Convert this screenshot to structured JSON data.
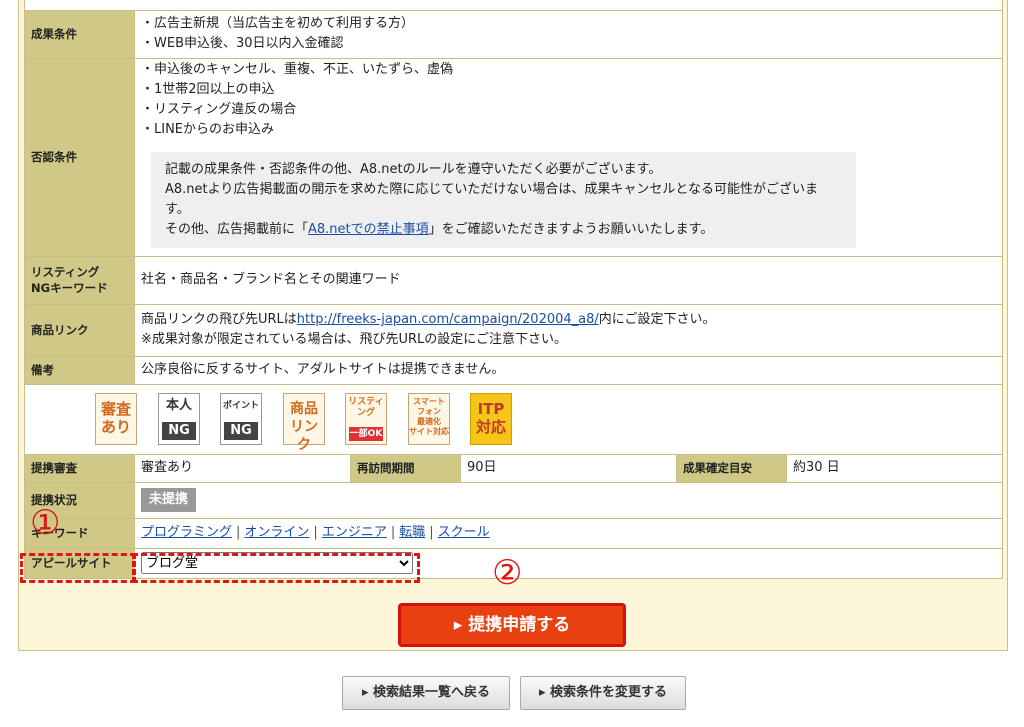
{
  "rows": {
    "success": {
      "label": "成果条件",
      "lines": [
        "・広告主新規（当広告主を初めて利用する方）",
        "・WEB申込後、30日以内入金確認"
      ]
    },
    "reject": {
      "label": "否認条件",
      "lines": [
        "・申込後のキャンセル、重複、不正、いたずら、虚偽",
        "・1世帯2回以上の申込",
        "・リスティング違反の場合",
        "・LINEからのお申込み"
      ],
      "note_line1": "記載の成果条件・否認条件の他、A8.netのルールを遵守いただく必要がございます。",
      "note_line2": "A8.netより広告掲載面の開示を求めた際に応じていただけない場合は、成果キャンセルとなる可能性がございます。",
      "note_line3_pre": "その他、広告掲載前に「",
      "note_link": "A8.netでの禁止事項",
      "note_line3_post": "」をご確認いただきますようお願いいたします。"
    },
    "listing": {
      "label_line1": "リスティング",
      "label_line2": "NGキーワード",
      "value": "社名・商品名・ブランド名とその関連ワード"
    },
    "product_link": {
      "label": "商品リンク",
      "pre": "商品リンクの飛び先URLは",
      "url": "http://freeks-japan.com/campaign/202004_a8/",
      "post": "内にご設定下さい。",
      "note": "※成果対象が限定されている場合は、飛び先URLの設定にご注意下さい。"
    },
    "remarks": {
      "label": "備考",
      "value": "公序良俗に反するサイト、アダルトサイトは提携できません。"
    },
    "review": {
      "label": "提携審査",
      "value": "審査あり",
      "revisit_label": "再訪問期間",
      "revisit_value": "90日",
      "confirm_label": "成果確定目安",
      "confirm_value": "約30 日"
    },
    "status": {
      "label": "提携状況",
      "value": "未提携"
    },
    "keywords": {
      "label": "キーワード",
      "items": [
        "プログラミング",
        "オンライン",
        "エンジニア",
        "転職",
        "スクール"
      ],
      "separator": "|"
    },
    "appeal": {
      "label": "アピールサイト",
      "selected": "ブログ堂"
    }
  },
  "badges": {
    "review": [
      "審査",
      "あり"
    ],
    "identity": {
      "top": "本人",
      "bottom": "NG"
    },
    "points": {
      "top": "ポイント",
      "bottom": "NG"
    },
    "product_link": [
      "商品",
      "リンク"
    ],
    "listing": {
      "top": "リスティ ング",
      "bottom": "一部OK"
    },
    "smartphone": [
      "スマート",
      "フォン",
      "最適化",
      "サイト対応"
    ],
    "itp": [
      "ITP",
      "対応"
    ]
  },
  "annotations": {
    "num1": "①",
    "num2": "②"
  },
  "buttons": {
    "submit": "▸ 提携申請する",
    "back": "▸ 検索結果一覧へ戻る",
    "change": "▸ 検索条件を変更する"
  },
  "colors": {
    "label_bg": "#cfc887",
    "panel_bg": "#fdf6d9",
    "submit_bg": "#e84010",
    "annotation_red": "#e01515"
  }
}
